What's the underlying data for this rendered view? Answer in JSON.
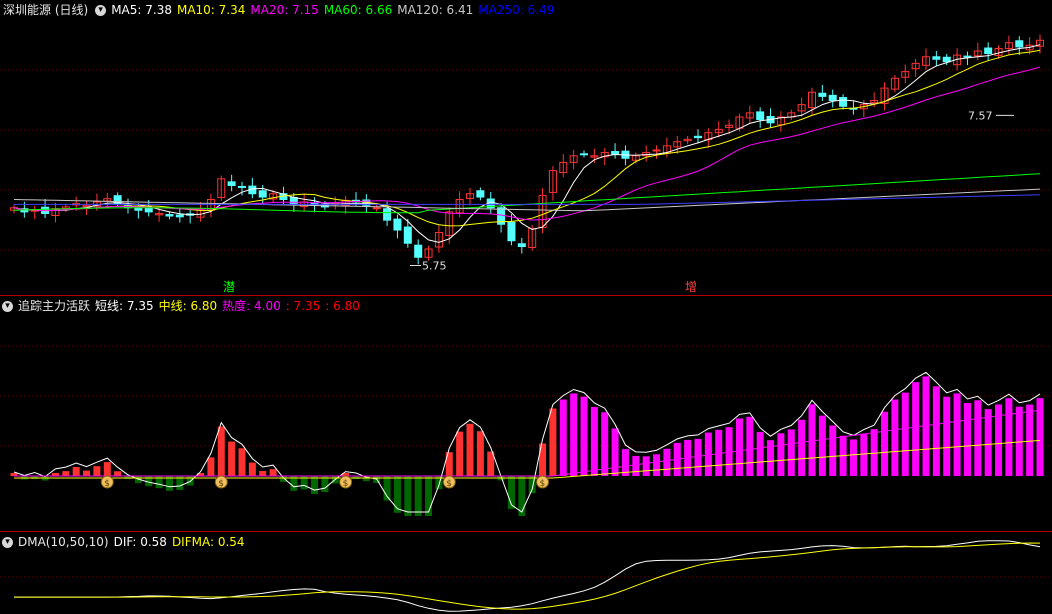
{
  "main": {
    "title": "深圳能源 (日线)",
    "indicators": [
      {
        "label": "MA5: 7.38",
        "color": "#ffffff"
      },
      {
        "label": "MA10: 7.34",
        "color": "#ffff00"
      },
      {
        "label": "MA20: 7.15",
        "color": "#ff00ff"
      },
      {
        "label": "MA60: 6.66",
        "color": "#00ff00"
      },
      {
        "label": "MA120: 6.41",
        "color": "#c8c8c8"
      },
      {
        "label": "MA250: 6.49",
        "color": "#0000ff"
      }
    ],
    "annotations": [
      {
        "label": "7.57"
      },
      {
        "label": "5.75"
      }
    ],
    "signals": [
      {
        "label": "潜",
        "color": "#00ff00"
      },
      {
        "label": "增",
        "color": "#ff4040"
      }
    ]
  },
  "sub1": {
    "title": "追踪主力活跃",
    "items": [
      {
        "label": "短线: 7.35",
        "color": "#ffffff"
      },
      {
        "label": "中线: 6.80",
        "color": "#ffff00"
      },
      {
        "label": "热度: 4.00",
        "color": "#ff00ff"
      },
      {
        "label": ": 7.35",
        "color": "#ff0000"
      },
      {
        "label": ": 6.80",
        "color": "#ff0000"
      }
    ],
    "marker_icon": "money-bag-icon"
  },
  "sub2": {
    "title": "DMA(10,50,10)",
    "items": [
      {
        "label": "DIF: 0.58",
        "color": "#ffffff"
      },
      {
        "label": "DIFMA: 0.54",
        "color": "#ffff00"
      }
    ]
  },
  "chart_data": [
    {
      "type": "candlestick",
      "title": "深圳能源 (日线)",
      "annotations": [
        {
          "label": "7.57",
          "y": 7.57
        },
        {
          "label": "5.75",
          "y": 5.75
        }
      ],
      "close_approx": [
        6.45,
        6.4,
        6.42,
        6.38,
        6.44,
        6.46,
        6.5,
        6.48,
        6.52,
        6.56,
        6.5,
        6.45,
        6.42,
        6.4,
        6.38,
        6.35,
        6.34,
        6.36,
        6.42,
        6.55,
        6.8,
        6.72,
        6.7,
        6.62,
        6.58,
        6.62,
        6.55,
        6.5,
        6.52,
        6.48,
        6.46,
        6.5,
        6.54,
        6.52,
        6.48,
        6.45,
        6.3,
        6.18,
        6.02,
        5.85,
        5.95,
        6.15,
        6.4,
        6.55,
        6.62,
        6.58,
        6.45,
        6.25,
        6.05,
        5.98,
        6.2,
        6.6,
        6.9,
        7.0,
        7.08,
        7.1,
        7.08,
        7.12,
        7.1,
        7.05,
        7.08,
        7.12,
        7.15,
        7.2,
        7.25,
        7.28,
        7.3,
        7.36,
        7.4,
        7.45,
        7.55,
        7.6,
        7.52,
        7.48,
        7.55,
        7.6,
        7.7,
        7.85,
        7.8,
        7.75,
        7.68,
        7.65,
        7.7,
        7.75,
        7.9,
        8.02,
        8.1,
        8.2,
        8.28,
        8.25,
        8.22,
        8.3,
        8.28,
        8.35,
        8.32,
        8.38,
        8.45,
        8.4,
        8.42,
        8.48
      ]
    },
    {
      "type": "bar",
      "title": "追踪主力活跃",
      "series": [
        {
          "name": "短线",
          "last": 7.35
        },
        {
          "name": "中线",
          "last": 6.8
        },
        {
          "name": "热度",
          "last": 4.0
        }
      ]
    },
    {
      "type": "line",
      "title": "DMA(10,50,10)",
      "series": [
        {
          "name": "DIF",
          "last": 0.58
        },
        {
          "name": "DIFMA",
          "last": 0.54
        }
      ]
    }
  ]
}
